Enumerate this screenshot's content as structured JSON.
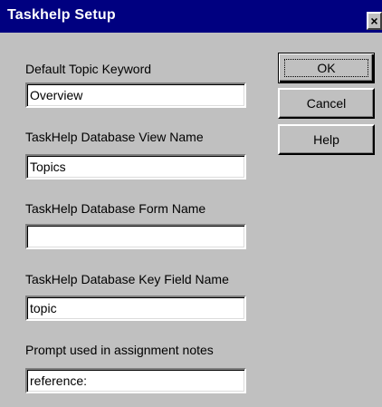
{
  "window": {
    "title": "Taskhelp Setup",
    "close_glyph": "×"
  },
  "fields": {
    "default_topic": {
      "label": "Default Topic Keyword",
      "value": "Overview"
    },
    "view_name": {
      "label": "TaskHelp Database View Name",
      "value": "Topics"
    },
    "form_name": {
      "label": "TaskHelp Database Form Name",
      "value": ""
    },
    "key_field": {
      "label": "TaskHelp Database Key Field Name",
      "value": "topic"
    },
    "prompt": {
      "label": "Prompt used in assignment notes",
      "value": "reference:"
    }
  },
  "buttons": {
    "ok": "OK",
    "cancel": "Cancel",
    "help": "Help"
  }
}
